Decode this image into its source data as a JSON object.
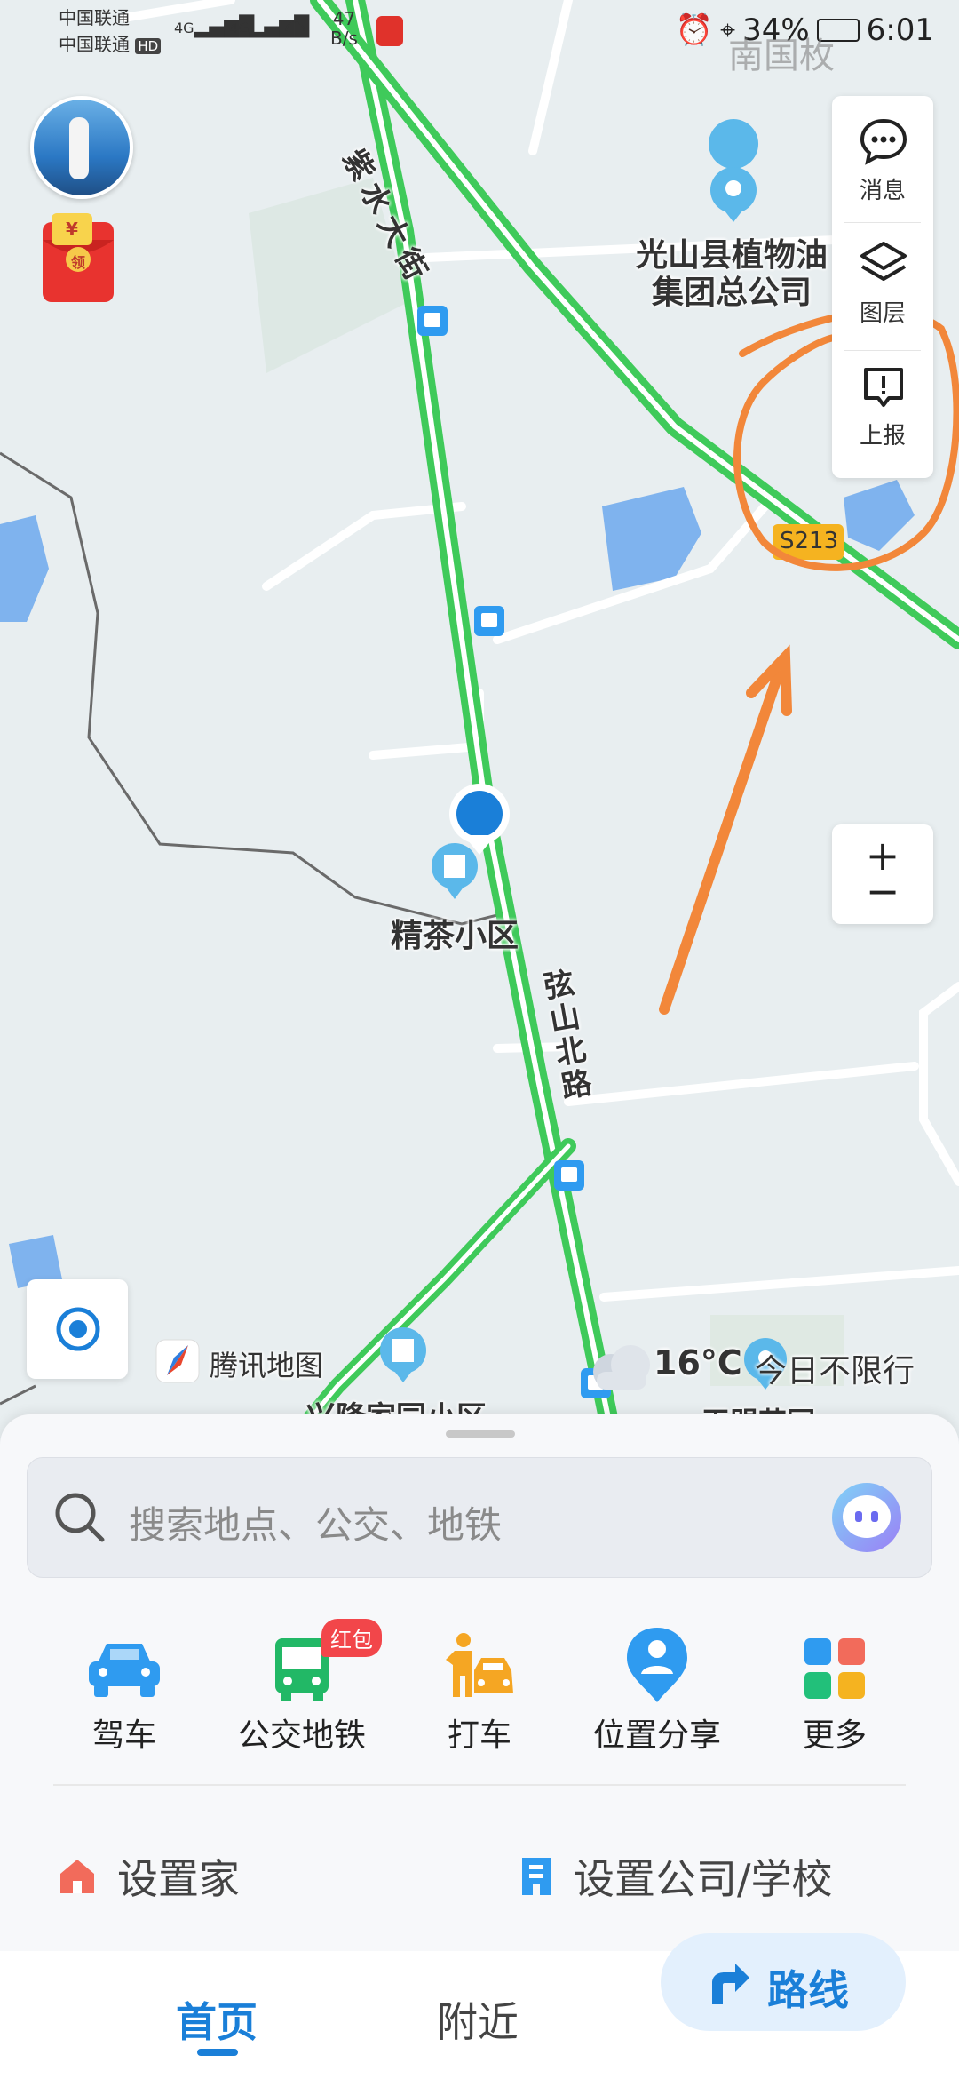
{
  "status_bar": {
    "carrier1": "中国联通",
    "carrier2": "中国联通",
    "hd": "HD",
    "net1": "4G",
    "net2": "4G",
    "speed_value": "47",
    "speed_unit": "B/s",
    "battery": "34%",
    "time": "6:01"
  },
  "watermark": "南国枚",
  "map_labels": {
    "poi_oil": "光山县植物油",
    "poi_oil_2": "集团总公司",
    "street_top": "紫水大街",
    "road_s213": "S213",
    "poi_jingcha": "精茶小区",
    "road_xianshan": "弦山北路",
    "tencent_logo_text": "腾讯地图",
    "poi_xinglong": "兴隆家园小区",
    "poi_bottom_right": "玉盟花园",
    "weather_temp": "16°C",
    "traffic_limit": "今日不限行"
  },
  "map_controls": {
    "message_label": "消息",
    "layers_label": "图层",
    "report_label": "上报",
    "zoom_in": "+",
    "zoom_out": "−"
  },
  "red_packet": {
    "currency_symbol": "¥",
    "claim_text": "领"
  },
  "search": {
    "placeholder": "搜索地点、公交、地铁"
  },
  "quick_actions": [
    {
      "label": "驾车",
      "icon": "car-icon",
      "color": "#2f9bf0"
    },
    {
      "label": "公交地铁",
      "icon": "bus-icon",
      "color": "#22b866",
      "badge": "红包"
    },
    {
      "label": "打车",
      "icon": "taxi-icon",
      "color": "#f5a623"
    },
    {
      "label": "位置分享",
      "icon": "location-share-icon",
      "color": "#2f9bf0"
    },
    {
      "label": "更多",
      "icon": "more-grid-icon",
      "color": "#f26b5b"
    }
  ],
  "shortcuts": {
    "home_label": "设置家",
    "company_label": "设置公司/学校"
  },
  "tabs": {
    "home": "首页",
    "nearby": "附近",
    "route": "路线"
  },
  "colors": {
    "accent": "#1a7fd8",
    "road_green": "#3fca5a",
    "annotation_orange": "#f2873a"
  }
}
